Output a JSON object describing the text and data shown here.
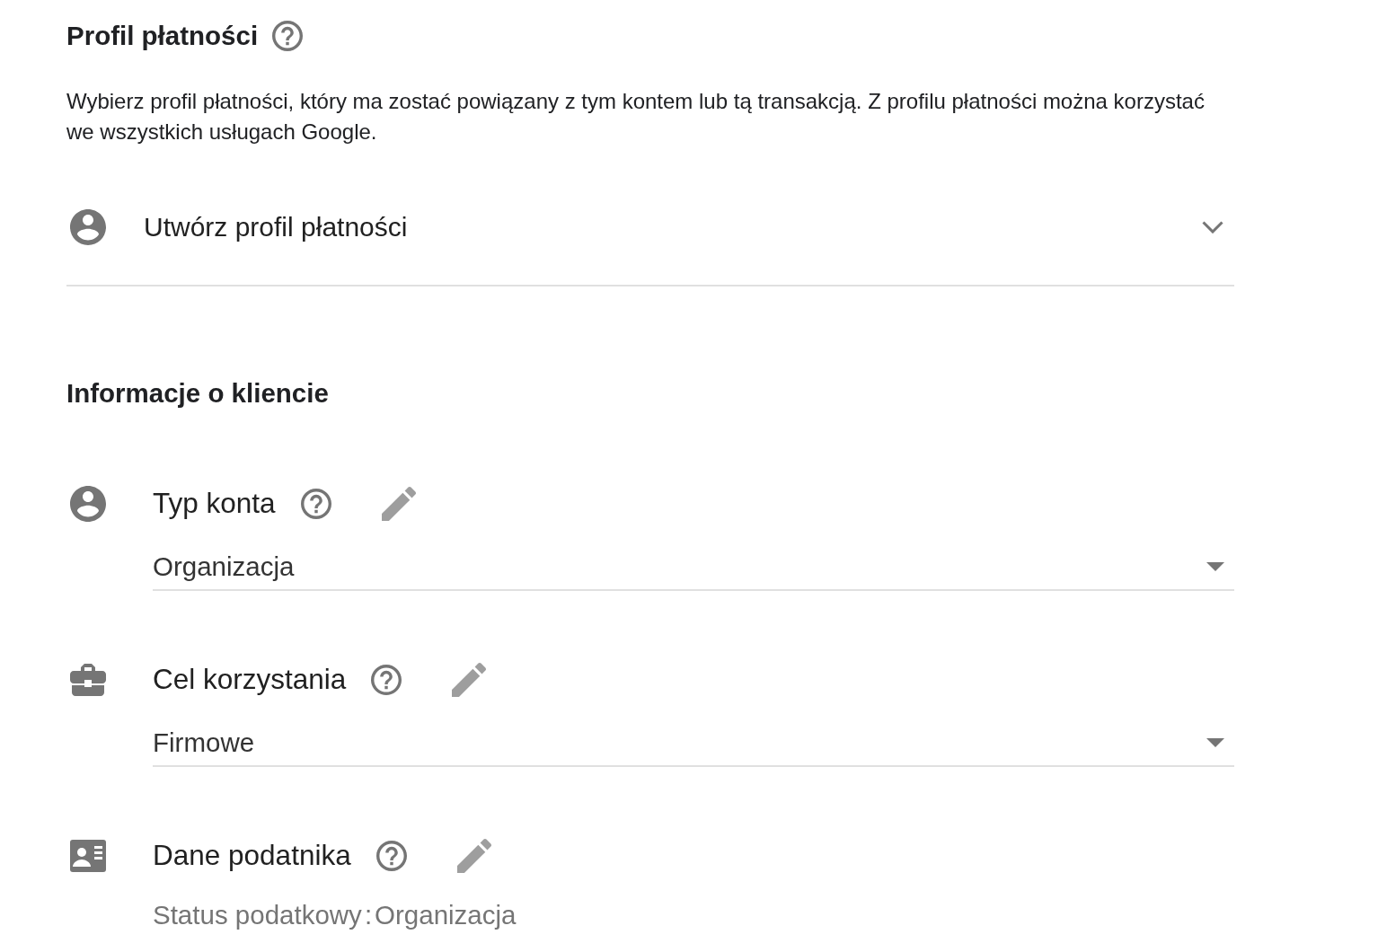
{
  "billing_profile": {
    "title": "Profil płatności",
    "description": "Wybierz profil płatności, który ma zostać powiązany z tym kontem lub tą transakcją. Z profilu płatności można korzystać we wszystkich usługach Google.",
    "selector": {
      "value": "Utwórz profil płatności",
      "expanded": false
    }
  },
  "customer_info": {
    "title": "Informacje o kliencie",
    "sections": [
      {
        "kind": "dropdown",
        "label": "Typ konta",
        "value": "Organizacja"
      },
      {
        "kind": "dropdown",
        "label": "Cel korzystania",
        "value": "Firmowe"
      },
      {
        "kind": "status",
        "label": "Dane podatnika",
        "status_label": "Status podatkowy",
        "separator": ":",
        "status_value": "Organizacja"
      }
    ]
  }
}
